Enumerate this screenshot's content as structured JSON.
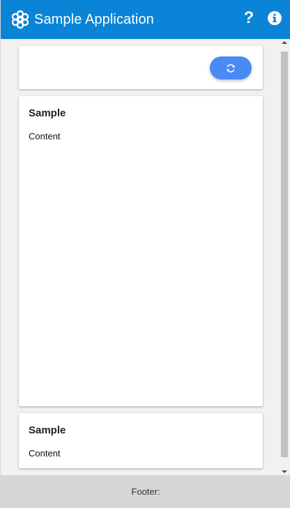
{
  "header": {
    "title": "Sample Application",
    "logo_icon": "flower-logo-icon",
    "help_label": "?",
    "info_icon": "info-icon",
    "background": "#0a84d6"
  },
  "toolbar": {
    "refresh_icon": "refresh-icon",
    "refresh_color": "#4a8af4"
  },
  "cards": [
    {
      "title": "Sample",
      "body": "Content"
    },
    {
      "title": "Sample",
      "body": "Content"
    }
  ],
  "footer": {
    "label": "Footer:"
  }
}
